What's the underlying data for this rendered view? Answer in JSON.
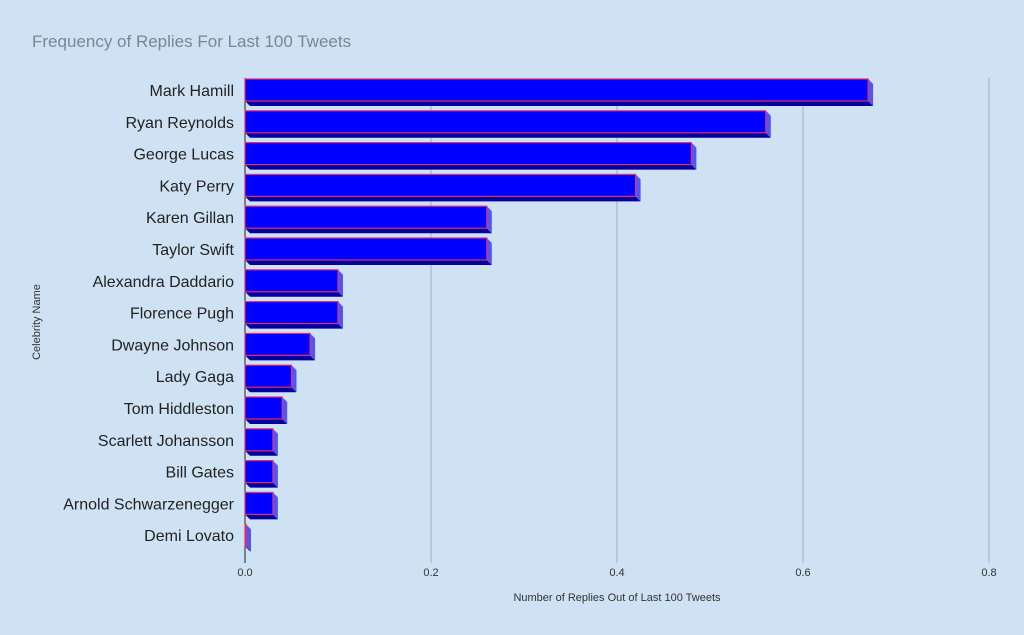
{
  "chart_data": {
    "type": "bar",
    "orientation": "horizontal",
    "style": "3d",
    "title": "Frequency of Replies For Last 100 Tweets",
    "xlabel": "Number of Replies Out of Last 100 Tweets",
    "ylabel": "Celebrity Name",
    "xlim": [
      0,
      0.8
    ],
    "xticks": [
      0.0,
      0.2,
      0.4,
      0.6,
      0.8
    ],
    "xtick_labels": [
      "0.0",
      "0.2",
      "0.4",
      "0.6",
      "0.8"
    ],
    "grid": true,
    "categories": [
      "Mark Hamill",
      "Ryan Reynolds",
      "George Lucas",
      "Katy Perry",
      "Karen Gillan",
      "Taylor Swift",
      "Alexandra Daddario",
      "Florence Pugh",
      "Dwayne Johnson",
      "Lady Gaga",
      "Tom Hiddleston",
      "Scarlett Johansson",
      "Bill Gates",
      "Arnold Schwarzenegger",
      "Demi Lovato"
    ],
    "values": [
      0.67,
      0.56,
      0.48,
      0.42,
      0.26,
      0.26,
      0.1,
      0.1,
      0.07,
      0.05,
      0.04,
      0.03,
      0.03,
      0.03,
      0.0
    ],
    "colors": {
      "bar_front": "#0000ff",
      "bar_edge": "#e0306a",
      "bar_side": "#5555ee",
      "bar_bottom": "#00009e",
      "background": "#cfe2f3",
      "grid": "#9fb0c0"
    }
  }
}
